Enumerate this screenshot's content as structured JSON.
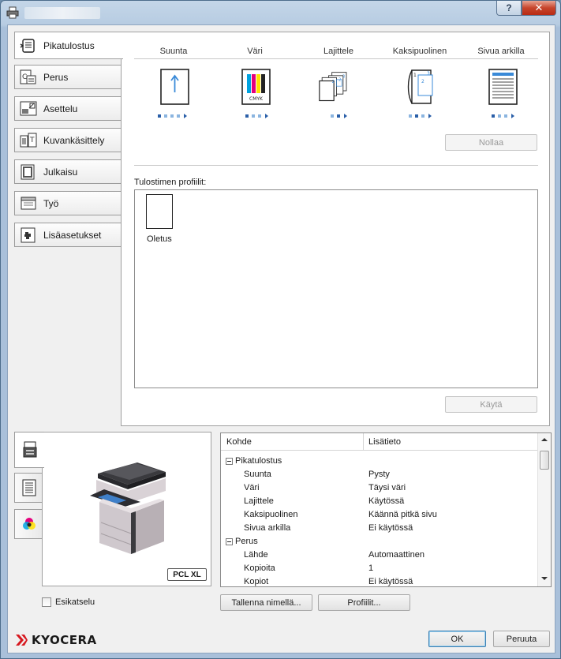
{
  "window": {
    "title": "",
    "help_label": "?",
    "close_label": "✕"
  },
  "sidebar": {
    "tabs": [
      {
        "label": "Pikatulostus",
        "icon": "quick-print-icon",
        "active": true
      },
      {
        "label": "Perus",
        "icon": "basic-icon"
      },
      {
        "label": "Asettelu",
        "icon": "layout-icon"
      },
      {
        "label": "Kuvankäsittely",
        "icon": "image-processing-icon"
      },
      {
        "label": "Julkaisu",
        "icon": "publishing-icon"
      },
      {
        "label": "Työ",
        "icon": "job-icon"
      },
      {
        "label": "Lisäasetukset",
        "icon": "advanced-icon"
      }
    ]
  },
  "quick_print": {
    "columns": [
      {
        "label": "Suunta",
        "icon": "orientation-icon"
      },
      {
        "label": "Väri",
        "icon": "color-icon",
        "cmyk": "CMYK"
      },
      {
        "label": "Lajittele",
        "icon": "collate-icon"
      },
      {
        "label": "Kaksipuolinen",
        "icon": "duplex-icon"
      },
      {
        "label": "Sivua arkilla",
        "icon": "pages-per-sheet-icon"
      }
    ],
    "reset_label": "Nollaa",
    "profiles_label": "Tulostimen profiilit:",
    "profiles": [
      {
        "label": "Oletus"
      }
    ],
    "apply_label": "Käytä"
  },
  "preview": {
    "badge": "PCL XL",
    "tabs": [
      "printer-tab",
      "page-tab",
      "color-tab"
    ]
  },
  "properties": {
    "headers": {
      "item": "Kohde",
      "detail": "Lisätieto"
    },
    "rows": [
      {
        "group": true,
        "key": "Pikatulostus",
        "value": ""
      },
      {
        "key": "Suunta",
        "value": "Pysty"
      },
      {
        "key": "Väri",
        "value": "Täysi väri"
      },
      {
        "key": "Lajittele",
        "value": "Käytössä"
      },
      {
        "key": "Kaksipuolinen",
        "value": "Käännä pitkä sivu"
      },
      {
        "key": "Sivua arkilla",
        "value": "Ei käytössä"
      },
      {
        "group": true,
        "key": "Perus",
        "value": ""
      },
      {
        "key": "Lähde",
        "value": "Automaattinen"
      },
      {
        "key": "Kopioita",
        "value": "1"
      },
      {
        "key": "Kopiot",
        "value": "Ei käytössä"
      }
    ]
  },
  "footer": {
    "preview_checkbox": "Esikatselu",
    "checkbox_checked": false,
    "save_as_label": "Tallenna nimellä...",
    "profiles_button": "Profiilit...",
    "ok_label": "OK",
    "cancel_label": "Peruuta",
    "logo_text": "KYOCERA",
    "logo_color": "#d71920"
  }
}
